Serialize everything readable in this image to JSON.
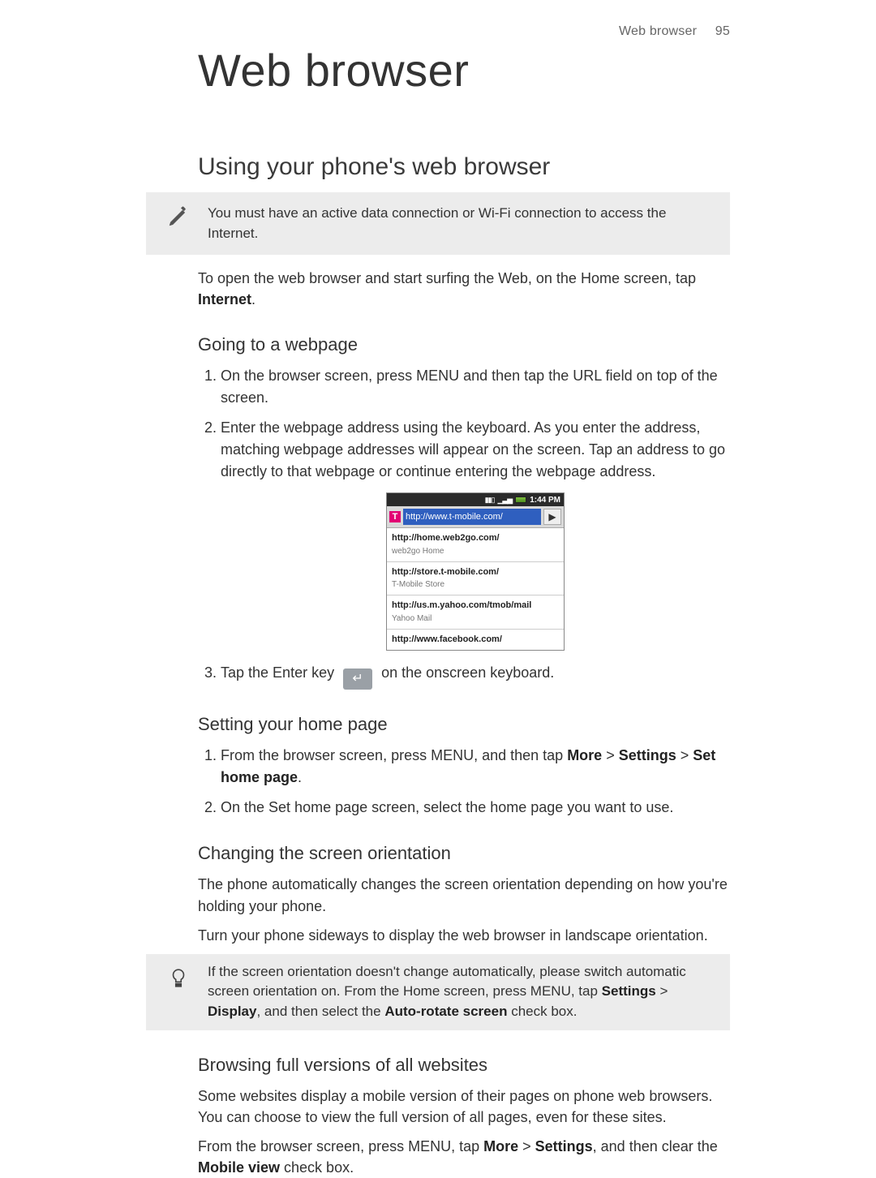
{
  "running_head": {
    "section": "Web browser",
    "page_number": "95"
  },
  "chapter_title": "Web browser",
  "section_title": "Using your phone's web browser",
  "note_connection": "You must have an active data connection or Wi-Fi connection to access the Internet.",
  "intro_prefix": "To open the web browser and start surfing the Web, on the Home screen, tap ",
  "intro_bold": "Internet",
  "intro_suffix": ".",
  "going": {
    "heading": "Going to a webpage",
    "step1": "On the browser screen, press MENU and then tap the URL field on top of the screen.",
    "step2": "Enter the webpage address using the keyboard. As you enter the address, matching webpage addresses will appear on the screen. Tap an address to go directly to that webpage or continue entering the webpage address.",
    "step3_a": "Tap the Enter key ",
    "step3_b": " on the onscreen keyboard."
  },
  "phone": {
    "time": "1:44 PM",
    "url_value": "http://www.t-mobile.com/",
    "suggestions": [
      {
        "url": "http://home.web2go.com/",
        "title": "web2go Home"
      },
      {
        "url": "http://store.t-mobile.com/",
        "title": "T-Mobile Store"
      },
      {
        "url": "http://us.m.yahoo.com/tmob/mail",
        "title": "Yahoo Mail"
      },
      {
        "url": "http://www.facebook.com/",
        "title": ""
      }
    ]
  },
  "homepage": {
    "heading": "Setting your home page",
    "step1_a": "From the browser screen, press MENU, and then tap ",
    "step1_b1": "More",
    "step1_sep1": " > ",
    "step1_b2": "Settings",
    "step1_sep2": " > ",
    "step1_b3": "Set home page",
    "step1_end": ".",
    "step2": "On the Set home page screen, select the home page you want to use."
  },
  "orientation": {
    "heading": "Changing the screen orientation",
    "p1": "The phone automatically changes the screen orientation depending on how you're holding your phone.",
    "p2": "Turn your phone sideways to display the web browser in landscape orientation.",
    "tip_a": "If the screen orientation doesn't change automatically, please switch automatic screen orientation on. From the Home screen, press MENU, tap ",
    "tip_b1": "Settings",
    "tip_sep": " > ",
    "tip_b2": "Display",
    "tip_mid": ", and then select the ",
    "tip_b3": "Auto-rotate screen",
    "tip_end": " check box."
  },
  "fullsites": {
    "heading": "Browsing full versions of all websites",
    "p1": "Some websites display a mobile version of their pages on phone web browsers. You can choose to view the full version of all pages, even for these sites.",
    "p2_a": "From the browser screen, press MENU, tap ",
    "p2_b1": "More",
    "p2_sep": " > ",
    "p2_b2": "Settings",
    "p2_mid": ", and then clear the ",
    "p2_b3": "Mobile view",
    "p2_end": " check box."
  }
}
